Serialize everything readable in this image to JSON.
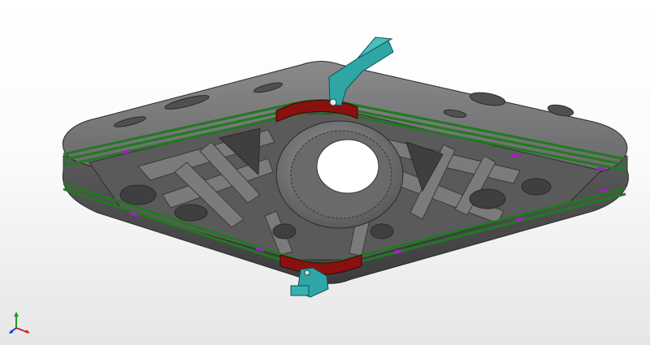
{
  "viewport": {
    "background_top": "#ffffff",
    "background_bottom": "#e6e6e6"
  },
  "model": {
    "body_color": "#6f6f70",
    "body_edge": "#2a2a2a",
    "band_color": "#1f7a1f",
    "highlight_color": "#8b1010",
    "insert_color": "#9b26b6",
    "clip_color": "#2ea6a6"
  },
  "triad": {
    "x_axis_color": "#d32020",
    "y_axis_color": "#1e9a1e",
    "z_axis_color": "#1e3cd0"
  }
}
